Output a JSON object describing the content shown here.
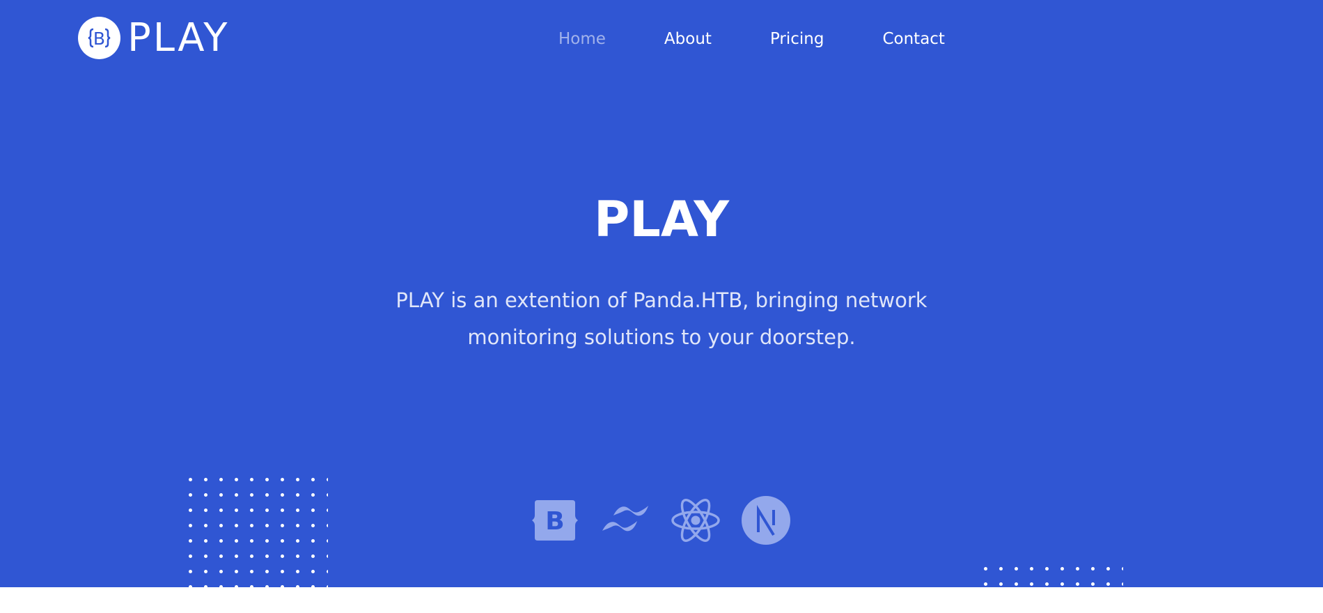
{
  "brand": {
    "name": "PLAY",
    "badge_letter": "B"
  },
  "nav": [
    {
      "label": "Home",
      "active": true
    },
    {
      "label": "About",
      "active": false
    },
    {
      "label": "Pricing",
      "active": false
    },
    {
      "label": "Contact",
      "active": false
    }
  ],
  "hero": {
    "title": "PLAY",
    "description": "PLAY is an extention of Panda.HTB, bringing network monitoring solutions to your doorstep."
  },
  "tech_icons": [
    "bootstrap-icon",
    "tailwind-icon",
    "react-icon",
    "nextjs-icon"
  ],
  "colors": {
    "primary": "#3056d3",
    "text": "#ffffff",
    "muted_icon": "#93a8ec"
  }
}
